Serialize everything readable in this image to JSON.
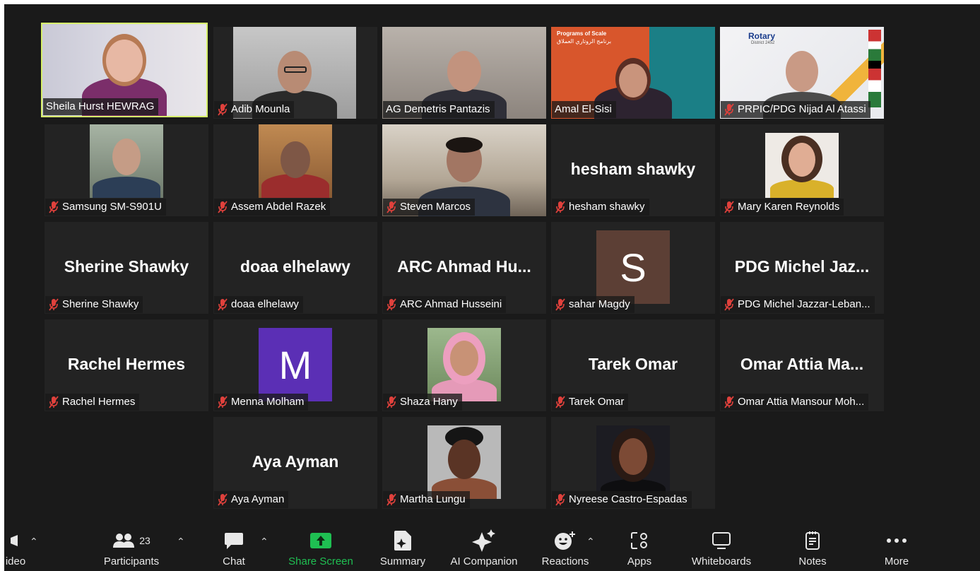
{
  "participants": [
    {
      "name": "Sheila Hurst HEWRAG",
      "muted": false,
      "active": true,
      "type": "video"
    },
    {
      "name": "Adib Mounla",
      "muted": true,
      "type": "video"
    },
    {
      "name": "AG Demetris Pantazis",
      "muted": false,
      "type": "video"
    },
    {
      "name": "Amal El-Sisi",
      "muted": false,
      "type": "video"
    },
    {
      "name": "PRPIC/PDG  Nijad Al Atassi",
      "muted": true,
      "type": "video"
    },
    {
      "name": "Samsung SM-S901U",
      "muted": true,
      "type": "video"
    },
    {
      "name": "Assem Abdel Razek",
      "muted": true,
      "type": "video"
    },
    {
      "name": "Steven Marcos",
      "muted": true,
      "type": "video"
    },
    {
      "name": "hesham shawky",
      "display": "hesham shawky",
      "muted": true,
      "type": "name"
    },
    {
      "name": "Mary Karen Reynolds",
      "muted": true,
      "type": "video"
    },
    {
      "name": "Sherine Shawky",
      "display": "Sherine Shawky",
      "muted": true,
      "type": "name"
    },
    {
      "name": "doaa elhelawy",
      "display": "doaa elhelawy",
      "muted": true,
      "type": "name"
    },
    {
      "name": "ARC Ahmad Husseini",
      "display": "ARC Ahmad Hu...",
      "muted": true,
      "type": "name"
    },
    {
      "name": "sahar Magdy",
      "letter": "S",
      "color": "#5c3f35",
      "muted": true,
      "type": "letter"
    },
    {
      "name": "PDG Michel Jazzar-Leban...",
      "display": "PDG Michel Jaz...",
      "muted": true,
      "type": "name"
    },
    {
      "name": "Rachel Hermes",
      "display": "Rachel Hermes",
      "muted": true,
      "type": "name"
    },
    {
      "name": "Menna Molham",
      "letter": "M",
      "color": "#5b2fb5",
      "muted": true,
      "type": "letter"
    },
    {
      "name": "Shaza Hany",
      "muted": true,
      "type": "video"
    },
    {
      "name": "Tarek Omar",
      "display": "Tarek Omar",
      "muted": true,
      "type": "name"
    },
    {
      "name": "Omar Attia Mansour Moh...",
      "display": "Omar Attia Ma...",
      "muted": true,
      "type": "name"
    },
    {
      "name": "Aya Ayman",
      "display": "Aya Ayman",
      "muted": true,
      "type": "name"
    },
    {
      "name": "Martha Lungu",
      "muted": true,
      "type": "video"
    },
    {
      "name": "Nyreese Castro-Espadas",
      "muted": true,
      "type": "video"
    }
  ],
  "slide": {
    "title": "Programs of Scale",
    "subtitle": "برنامج الروتاري العملاق",
    "rotary": "Rotary",
    "district": "District 2452"
  },
  "toolbar": {
    "video": "ideo",
    "participants": "Participants",
    "participant_count": "23",
    "chat": "Chat",
    "share_screen": "Share Screen",
    "summary": "Summary",
    "ai_companion": "AI Companion",
    "reactions": "Reactions",
    "apps": "Apps",
    "whiteboards": "Whiteboards",
    "notes": "Notes",
    "more": "More"
  },
  "colors": {
    "accent_green": "#1fbf52",
    "active_border": "#d6f06a",
    "mute_red": "#e0413c"
  }
}
